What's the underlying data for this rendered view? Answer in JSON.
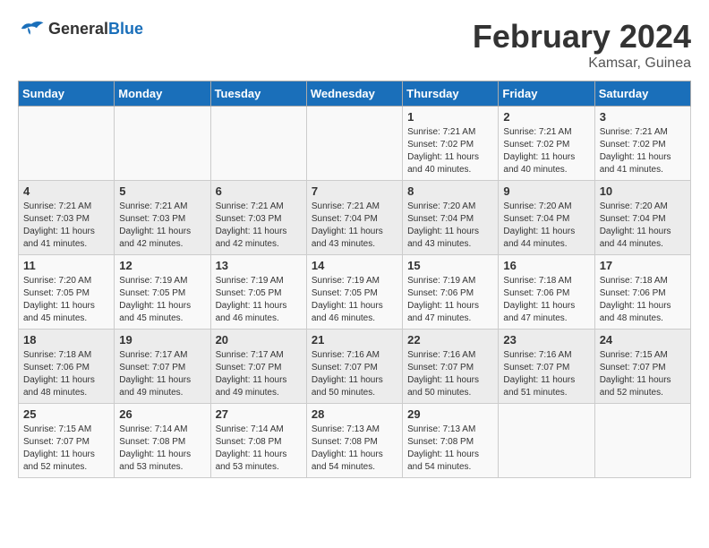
{
  "header": {
    "logo_general": "General",
    "logo_blue": "Blue",
    "title": "February 2024",
    "subtitle": "Kamsar, Guinea"
  },
  "weekdays": [
    "Sunday",
    "Monday",
    "Tuesday",
    "Wednesday",
    "Thursday",
    "Friday",
    "Saturday"
  ],
  "weeks": [
    [
      {
        "day": "",
        "info": ""
      },
      {
        "day": "",
        "info": ""
      },
      {
        "day": "",
        "info": ""
      },
      {
        "day": "",
        "info": ""
      },
      {
        "day": "1",
        "info": "Sunrise: 7:21 AM\nSunset: 7:02 PM\nDaylight: 11 hours\nand 40 minutes."
      },
      {
        "day": "2",
        "info": "Sunrise: 7:21 AM\nSunset: 7:02 PM\nDaylight: 11 hours\nand 40 minutes."
      },
      {
        "day": "3",
        "info": "Sunrise: 7:21 AM\nSunset: 7:02 PM\nDaylight: 11 hours\nand 41 minutes."
      }
    ],
    [
      {
        "day": "4",
        "info": "Sunrise: 7:21 AM\nSunset: 7:03 PM\nDaylight: 11 hours\nand 41 minutes."
      },
      {
        "day": "5",
        "info": "Sunrise: 7:21 AM\nSunset: 7:03 PM\nDaylight: 11 hours\nand 42 minutes."
      },
      {
        "day": "6",
        "info": "Sunrise: 7:21 AM\nSunset: 7:03 PM\nDaylight: 11 hours\nand 42 minutes."
      },
      {
        "day": "7",
        "info": "Sunrise: 7:21 AM\nSunset: 7:04 PM\nDaylight: 11 hours\nand 43 minutes."
      },
      {
        "day": "8",
        "info": "Sunrise: 7:20 AM\nSunset: 7:04 PM\nDaylight: 11 hours\nand 43 minutes."
      },
      {
        "day": "9",
        "info": "Sunrise: 7:20 AM\nSunset: 7:04 PM\nDaylight: 11 hours\nand 44 minutes."
      },
      {
        "day": "10",
        "info": "Sunrise: 7:20 AM\nSunset: 7:04 PM\nDaylight: 11 hours\nand 44 minutes."
      }
    ],
    [
      {
        "day": "11",
        "info": "Sunrise: 7:20 AM\nSunset: 7:05 PM\nDaylight: 11 hours\nand 45 minutes."
      },
      {
        "day": "12",
        "info": "Sunrise: 7:19 AM\nSunset: 7:05 PM\nDaylight: 11 hours\nand 45 minutes."
      },
      {
        "day": "13",
        "info": "Sunrise: 7:19 AM\nSunset: 7:05 PM\nDaylight: 11 hours\nand 46 minutes."
      },
      {
        "day": "14",
        "info": "Sunrise: 7:19 AM\nSunset: 7:05 PM\nDaylight: 11 hours\nand 46 minutes."
      },
      {
        "day": "15",
        "info": "Sunrise: 7:19 AM\nSunset: 7:06 PM\nDaylight: 11 hours\nand 47 minutes."
      },
      {
        "day": "16",
        "info": "Sunrise: 7:18 AM\nSunset: 7:06 PM\nDaylight: 11 hours\nand 47 minutes."
      },
      {
        "day": "17",
        "info": "Sunrise: 7:18 AM\nSunset: 7:06 PM\nDaylight: 11 hours\nand 48 minutes."
      }
    ],
    [
      {
        "day": "18",
        "info": "Sunrise: 7:18 AM\nSunset: 7:06 PM\nDaylight: 11 hours\nand 48 minutes."
      },
      {
        "day": "19",
        "info": "Sunrise: 7:17 AM\nSunset: 7:07 PM\nDaylight: 11 hours\nand 49 minutes."
      },
      {
        "day": "20",
        "info": "Sunrise: 7:17 AM\nSunset: 7:07 PM\nDaylight: 11 hours\nand 49 minutes."
      },
      {
        "day": "21",
        "info": "Sunrise: 7:16 AM\nSunset: 7:07 PM\nDaylight: 11 hours\nand 50 minutes."
      },
      {
        "day": "22",
        "info": "Sunrise: 7:16 AM\nSunset: 7:07 PM\nDaylight: 11 hours\nand 50 minutes."
      },
      {
        "day": "23",
        "info": "Sunrise: 7:16 AM\nSunset: 7:07 PM\nDaylight: 11 hours\nand 51 minutes."
      },
      {
        "day": "24",
        "info": "Sunrise: 7:15 AM\nSunset: 7:07 PM\nDaylight: 11 hours\nand 52 minutes."
      }
    ],
    [
      {
        "day": "25",
        "info": "Sunrise: 7:15 AM\nSunset: 7:07 PM\nDaylight: 11 hours\nand 52 minutes."
      },
      {
        "day": "26",
        "info": "Sunrise: 7:14 AM\nSunset: 7:08 PM\nDaylight: 11 hours\nand 53 minutes."
      },
      {
        "day": "27",
        "info": "Sunrise: 7:14 AM\nSunset: 7:08 PM\nDaylight: 11 hours\nand 53 minutes."
      },
      {
        "day": "28",
        "info": "Sunrise: 7:13 AM\nSunset: 7:08 PM\nDaylight: 11 hours\nand 54 minutes."
      },
      {
        "day": "29",
        "info": "Sunrise: 7:13 AM\nSunset: 7:08 PM\nDaylight: 11 hours\nand 54 minutes."
      },
      {
        "day": "",
        "info": ""
      },
      {
        "day": "",
        "info": ""
      }
    ]
  ]
}
